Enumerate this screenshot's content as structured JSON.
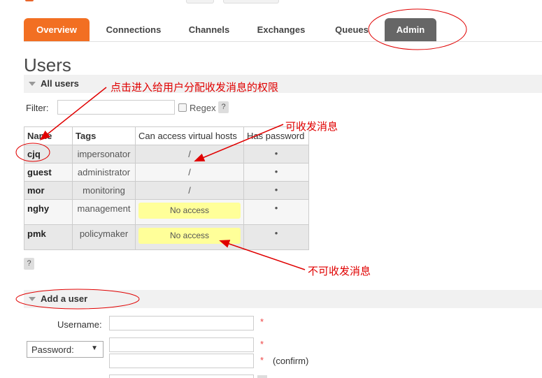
{
  "nav": {
    "tabs": [
      {
        "label": "Overview"
      },
      {
        "label": "Connections"
      },
      {
        "label": "Channels"
      },
      {
        "label": "Exchanges"
      },
      {
        "label": "Queues"
      },
      {
        "label": "Admin"
      }
    ]
  },
  "page_title": "Users",
  "all_users": {
    "section_title": "All users",
    "filter_label": "Filter:",
    "filter_value": "",
    "regex_label": "Regex",
    "help_label": "?",
    "columns": [
      "Name",
      "Tags",
      "Can access virtual hosts",
      "Has password"
    ],
    "rows": [
      {
        "name": "cjq",
        "tags": "impersonator",
        "vhosts": "/",
        "has_password": "•"
      },
      {
        "name": "guest",
        "tags": "administrator",
        "vhosts": "/",
        "has_password": "•"
      },
      {
        "name": "mor",
        "tags": "monitoring",
        "vhosts": "/",
        "has_password": "•"
      },
      {
        "name": "nghy",
        "tags": "management",
        "vhosts": "No access",
        "has_password": "•"
      },
      {
        "name": "pmk",
        "tags": "policymaker",
        "vhosts": "No access",
        "has_password": "•"
      }
    ],
    "table_help": "?"
  },
  "add_user": {
    "section_title": "Add a user",
    "username_label": "Username:",
    "password_option": "Password:",
    "required_mark": "*",
    "confirm_label": "(confirm)"
  },
  "annotations": {
    "click_hint": "点击进入给用户分配收发消息的权限",
    "can_send": "可收发消息",
    "cannot_send": "不可收发消息"
  },
  "colors": {
    "accent": "#f26f22",
    "admin_tab": "#666666",
    "no_access": "#ffff99",
    "annotation": "#e00000"
  }
}
